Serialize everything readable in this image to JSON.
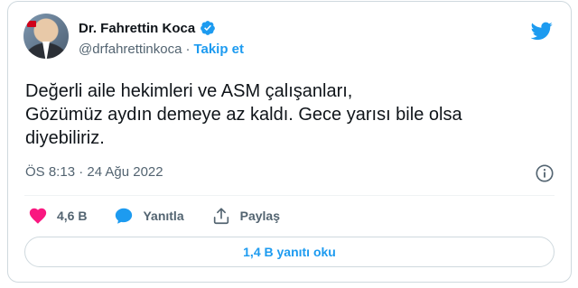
{
  "author": {
    "name": "Dr. Fahrettin Koca",
    "handle": "@drfahrettinkoca",
    "separator": "·",
    "follow_label": "Takip et",
    "verified_icon": "verified-badge-icon",
    "accent_color": "#1d9bf0"
  },
  "tweet": {
    "lines": [
      "Değerli aile hekimleri ve ASM çalışanları,",
      "Gözümüz aydın demeye az kaldı. Gece yarısı bile olsa",
      "diyebiliriz."
    ],
    "timestamp": "ÖS 8:13 · 24 Ağu 2022"
  },
  "actions": {
    "like_count": "4,6 B",
    "reply_label": "Yanıtla",
    "share_label": "Paylaş",
    "like_color": "#f91880"
  },
  "replies": {
    "button_label": "1,4 B yanıtı oku"
  },
  "icons": {
    "brand": "twitter-bird-icon",
    "info": "info-icon",
    "like": "heart-icon",
    "reply": "speech-bubble-icon",
    "share": "share-upload-icon"
  }
}
